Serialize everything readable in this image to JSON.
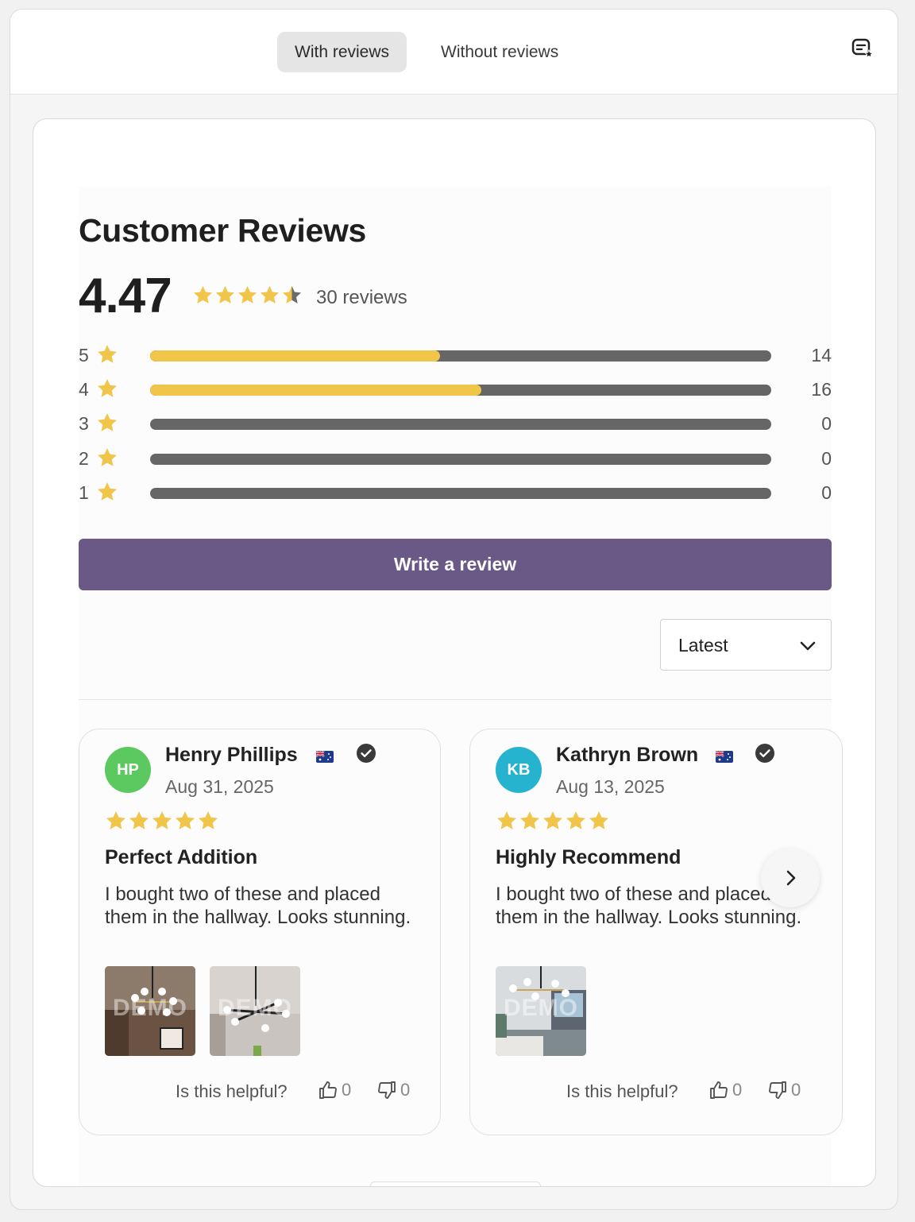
{
  "tabs": [
    {
      "label": "With reviews",
      "active": true
    },
    {
      "label": "Without reviews",
      "active": false
    }
  ],
  "top_icon": "feedback-icon",
  "widget": {
    "title": "Customer Reviews",
    "average": "4.47",
    "average_stars_fraction": 0.894,
    "review_count": "30 reviews",
    "distribution": [
      {
        "stars": "5",
        "count": "14",
        "fraction": 0.467
      },
      {
        "stars": "4",
        "count": "16",
        "fraction": 0.533
      },
      {
        "stars": "3",
        "count": "0",
        "fraction": 0
      },
      {
        "stars": "2",
        "count": "0",
        "fraction": 0
      },
      {
        "stars": "1",
        "count": "0",
        "fraction": 0
      }
    ],
    "write_review_label": "Write a review",
    "sort_selected": "Latest"
  },
  "reviews": [
    {
      "initials": "HP",
      "avatar_color": "#5bc95f",
      "name": "Henry Phillips",
      "flag": "australia-flag-icon",
      "date": "Aug 31, 2025",
      "rating": 5,
      "title": "Perfect Addition",
      "body": "I bought two of these and placed them in the hallway. Looks stunning.",
      "images": [
        "DEMO",
        "DEMO"
      ],
      "helpful_label": "Is this helpful?",
      "likes": "0",
      "dislikes": "0"
    },
    {
      "initials": "KB",
      "avatar_color": "#26b3cf",
      "name": "Kathryn Brown",
      "flag": "australia-flag-icon",
      "date": "Aug 13, 2025",
      "rating": 5,
      "title": "Highly Recommend",
      "body": "I bought two of these and placed them in the hallway. Looks stunning.",
      "images": [
        "DEMO"
      ],
      "helpful_label": "Is this helpful?",
      "likes": "0",
      "dislikes": "0"
    }
  ],
  "colors": {
    "accent": "#6a5987",
    "star": "#f1c54a",
    "bar_track": "#666666"
  }
}
